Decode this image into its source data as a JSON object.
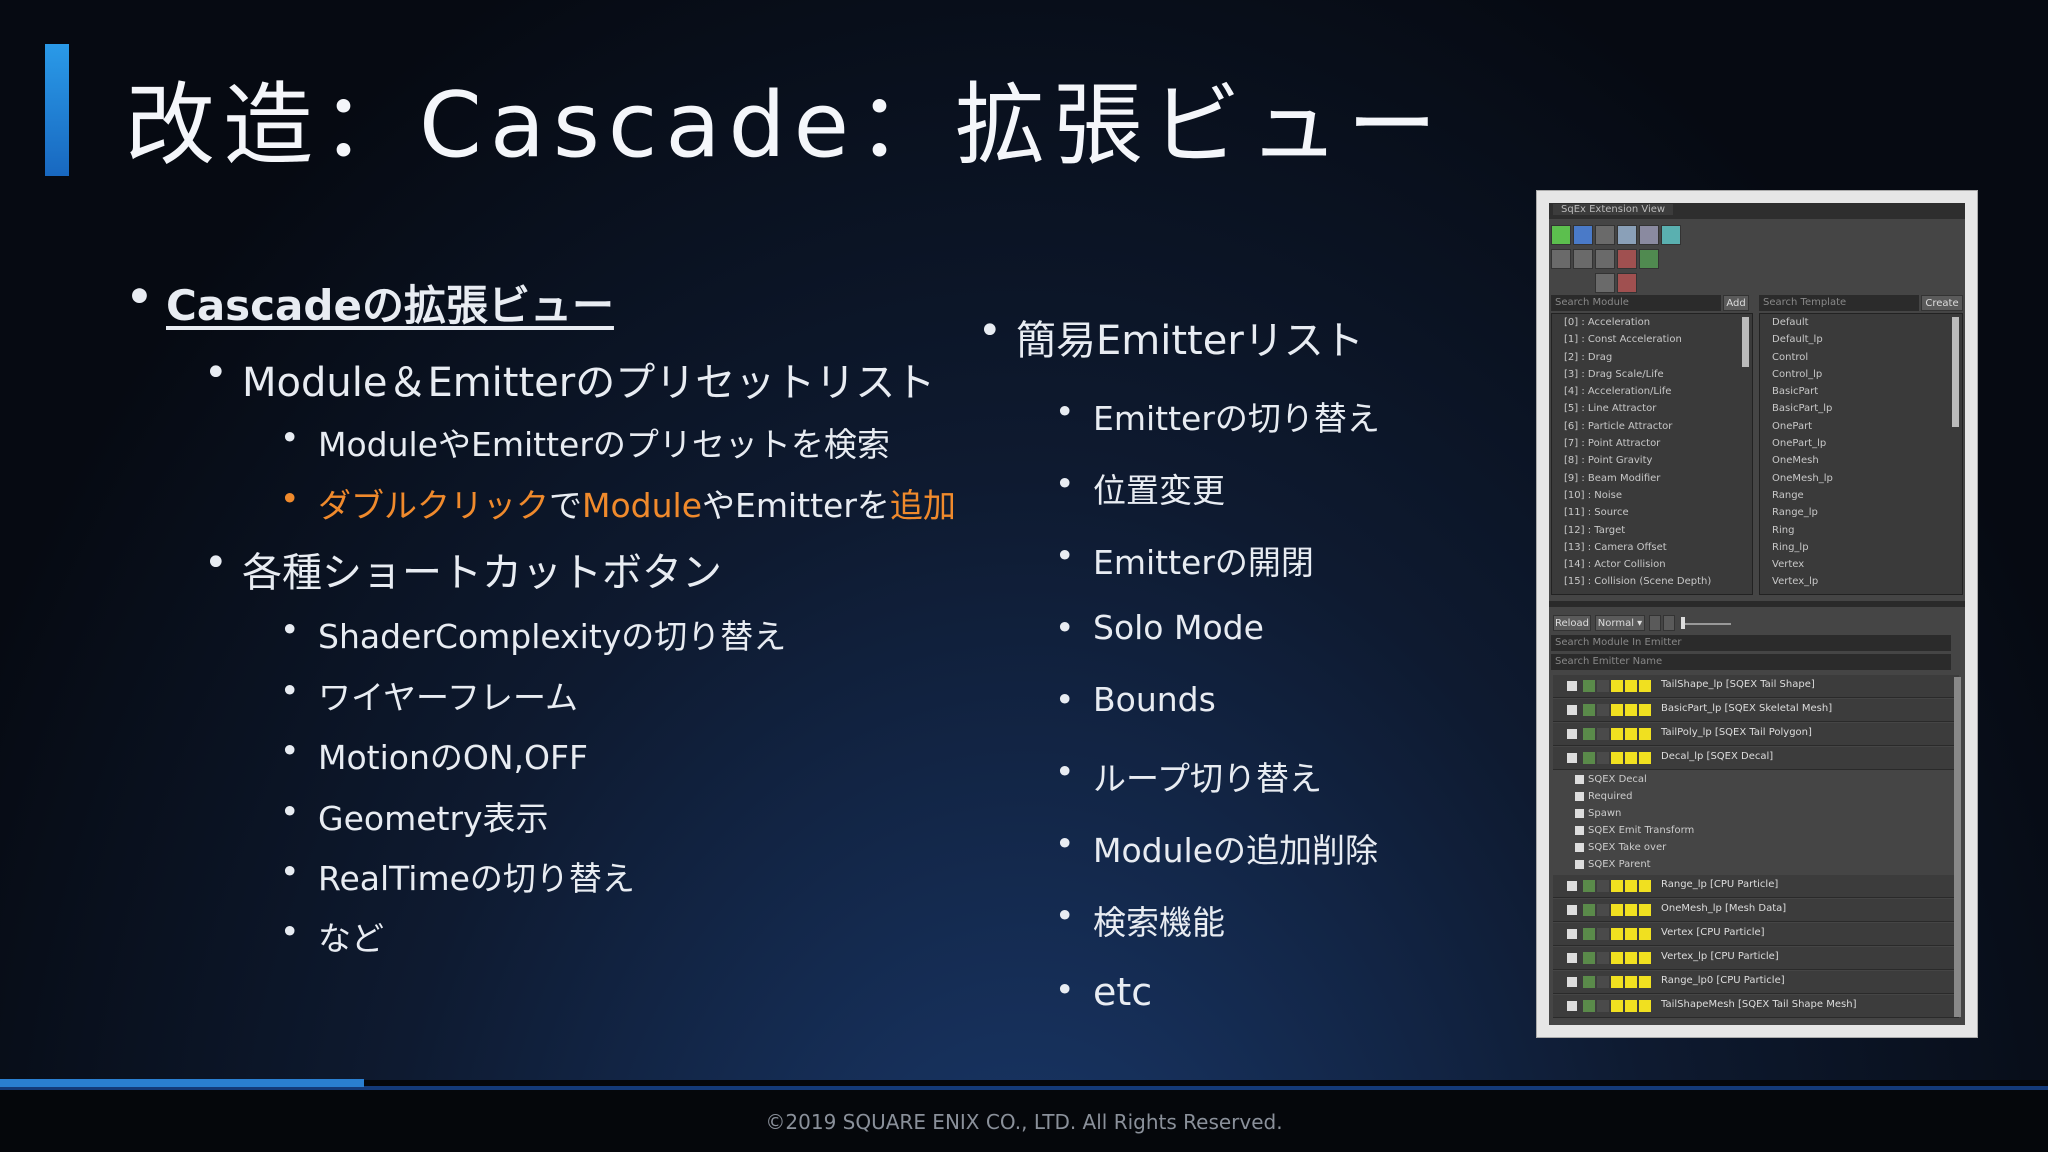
{
  "title": "改造：Cascade：拡張ビュー",
  "left_list": {
    "heading": "Cascadeの拡張ビュー",
    "group1": {
      "label": "Module＆Emitterのプリセットリスト",
      "items": [
        "ModuleやEmitterのプリセットを検索"
      ],
      "highlight": {
        "a": "ダブルクリック",
        "b": "で",
        "c": "Module",
        "d": "やEmitterを",
        "e": "追加"
      }
    },
    "group2": {
      "label": "各種ショートカットボタン",
      "items": [
        "ShaderComplexityの切り替え",
        "ワイヤーフレーム",
        "MotionのON,OFF",
        "Geometry表示",
        "RealTimeの切り替え",
        "など"
      ]
    }
  },
  "right_list": {
    "heading": "簡易Emitterリスト",
    "items": [
      "Emitterの切り替え",
      "位置変更",
      "Emitterの開閉",
      "Solo Mode",
      "Bounds",
      "ループ切り替え",
      "Moduleの追加削除",
      "検索機能",
      "etc"
    ]
  },
  "panel": {
    "tab": "SqEx Extension View",
    "search_module": "Search Module",
    "add": "Add",
    "search_template": "Search Template",
    "create": "Create",
    "modules": [
      "[0] : Acceleration",
      "[1] : Const Acceleration",
      "[2] : Drag",
      "[3] : Drag Scale/Life",
      "[4] : Acceleration/Life",
      "[5] : Line Attractor",
      "[6] : Particle Attractor",
      "[7] : Point Attractor",
      "[8] : Point Gravity",
      "[9] : Beam Modifier",
      "[10] : Noise",
      "[11] : Source",
      "[12] : Target",
      "[13] : Camera Offset",
      "[14] : Actor Collision",
      "[15] : Collision (Scene Depth)"
    ],
    "templates": [
      "Default",
      "Default_lp",
      "Control",
      "Control_lp",
      "BasicPart",
      "BasicPart_lp",
      "OnePart",
      "OnePart_lp",
      "OneMesh",
      "OneMesh_lp",
      "Range",
      "Range_lp",
      "Ring",
      "Ring_lp",
      "Vertex",
      "Vertex_lp"
    ],
    "reload": "Reload",
    "normal": "Normal ▾",
    "search_module_emitter": "Search Module In Emitter",
    "search_emitter": "Search Emitter Name",
    "emitters": [
      "TailShape_lp [SQEX Tail Shape]",
      "BasicPart_lp [SQEX Skeletal Mesh]",
      "TailPoly_lp [SQEX Tail Polygon]",
      "Decal_lp [SQEX Decal]"
    ],
    "decal_modules": [
      "SQEX Decal",
      "Required",
      "Spawn",
      "SQEX Emit Transform",
      "SQEX Take over",
      "SQEX Parent"
    ],
    "emitters2": [
      "Range_lp [CPU Particle]",
      "OneMesh_lp [Mesh Data]",
      "Vertex [CPU Particle]",
      "Vertex_lp [CPU Particle]",
      "Range_lp0 [CPU Particle]",
      "TailShapeMesh [SQEX Tail Shape Mesh]"
    ]
  },
  "footer": "©2019 SQUARE ENIX CO., LTD. All Rights Reserved."
}
